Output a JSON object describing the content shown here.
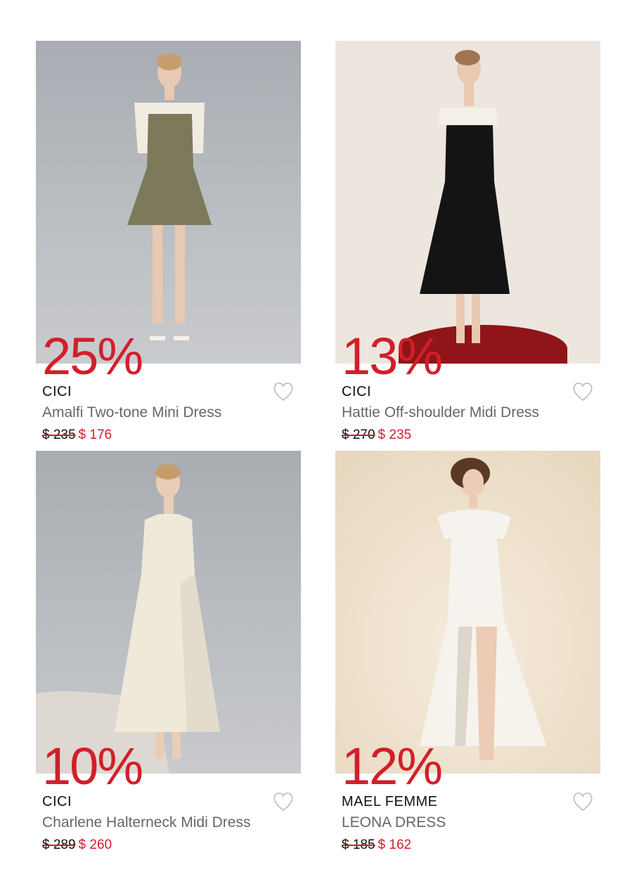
{
  "products": [
    {
      "discount": "25%",
      "brand": "CICI",
      "name": "Amalfi Two-tone Mini Dress",
      "old_price": "$ 235",
      "new_price": "$ 176",
      "photo": "model-in-olive-mini-dress",
      "bg": "#b9bcc1",
      "dress": "#7d7a5c",
      "accent": "#f1ece0",
      "icon": "heart-outline-icon"
    },
    {
      "discount": "13%",
      "brand": "CICI",
      "name": "Hattie Off-shoulder Midi Dress",
      "old_price": "$ 270",
      "new_price": "$ 235",
      "photo": "model-in-black-midi-dress",
      "bg": "#ece6df",
      "dress": "#141414",
      "accent": "#f4efe7",
      "icon": "heart-outline-icon"
    },
    {
      "discount": "10%",
      "brand": "CICI",
      "name": "Charlene Halterneck Midi Dress",
      "old_price": "$ 289",
      "new_price": "$ 260",
      "photo": "model-in-ivory-halter-dress",
      "bg": "#b8bbbf",
      "dress": "#efe9da",
      "accent": "#e3dccb",
      "icon": "heart-outline-icon"
    },
    {
      "discount": "12%",
      "brand": "MAEL FEMME",
      "name": "LEONA DRESS",
      "old_price": "$ 185",
      "new_price": "$ 162",
      "photo": "model-in-white-ruffle-gown",
      "bg": "#efe3cf",
      "dress": "#f6f3ee",
      "accent": "#ddd6cb",
      "icon": "heart-outline-icon"
    }
  ],
  "colors": {
    "sale": "#d21f2a",
    "text": "#111111",
    "muted": "#666666"
  }
}
